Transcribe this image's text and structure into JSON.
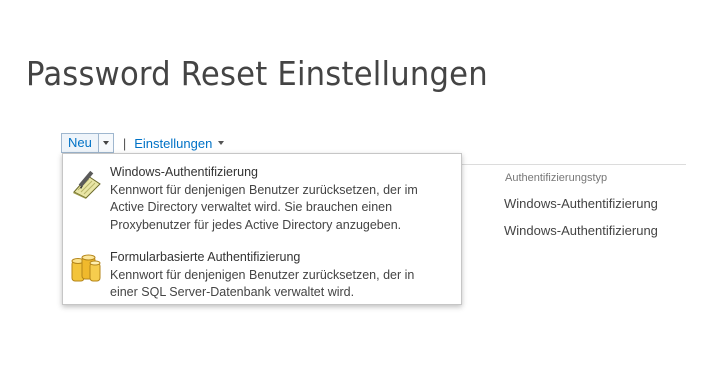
{
  "page": {
    "title": "Password Reset Einstellungen"
  },
  "toolbar": {
    "new_label": "Neu",
    "separator": "|",
    "settings_label": "Einstellungen"
  },
  "list": {
    "column_header": "Authentifizierungstyp",
    "rows": [
      "Windows-Authentifizierung",
      "Windows-Authentifizierung"
    ]
  },
  "new_menu": {
    "items": [
      {
        "title": "Windows-Authentifizierung",
        "icon": "notebook-pen-icon",
        "description_lines": [
          "Kennwort für denjenigen Benutzer zurücksetzen, der im",
          "Active Directory verwaltet wird. Sie brauchen einen",
          "Proxybenutzer für jedes Active Directory anzugeben."
        ]
      },
      {
        "title": "Formularbasierte Authentifizierung",
        "icon": "database-icon",
        "description_lines": [
          "Kennwort für denjenigen Benutzer zurücksetzen, der in",
          "einer SQL Server-Datenbank verwaltet wird."
        ]
      }
    ]
  }
}
